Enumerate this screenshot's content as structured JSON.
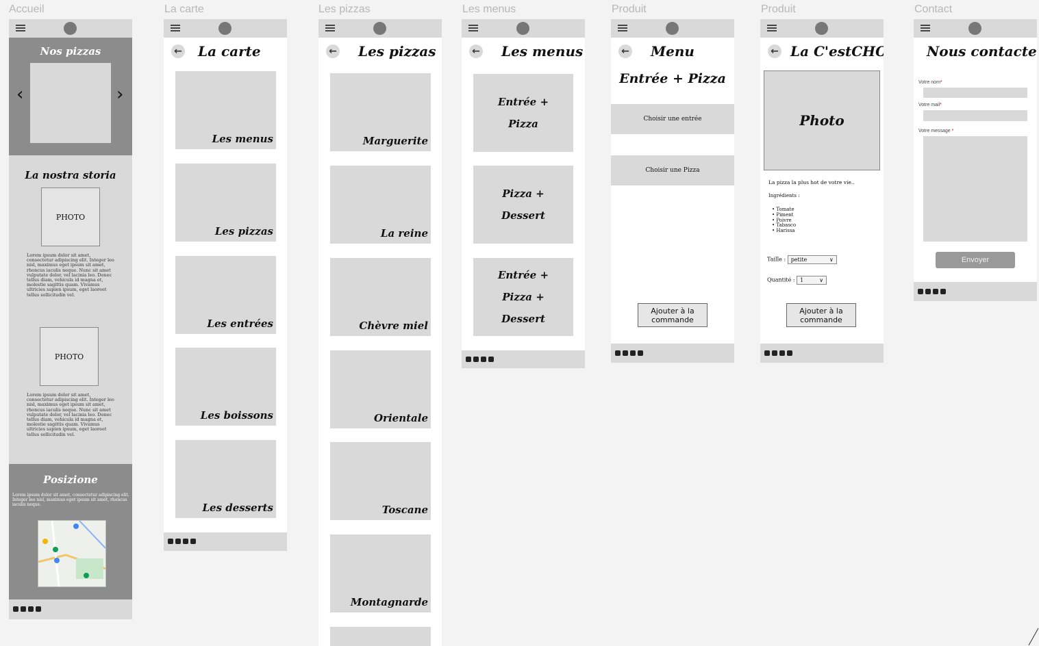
{
  "labels": [
    "Accueil",
    "La carte",
    "Les pizzas",
    "Les menus",
    "Produit",
    "Produit",
    "Contact"
  ],
  "accueil": {
    "hero_title": "Nos pizzas",
    "prev_arrow": "‹",
    "next_arrow": "›",
    "story_title": "La nostra storia",
    "photo1": "PHOTO",
    "lorem1": "Lorem ipsum dolor sit amet, consectetur adipiscing elit. Integer leo nisl, maximus eget ipsum sit amet, rhoncus iaculis neque. Nunc sit amet vulputate dolor, vel lacinia leo. Donec tellus diam, vehicula id magna et, molestie sagittis quam. Vivamus ultricies sapien ipsum, eget laoreet tellus sollicitudin vel.",
    "photo2": "PHOTO",
    "lorem2": "Lorem ipsum dolor sit amet, consectetur adipiscing elit. Integer leo nisl, maximus eget ipsum sit amet, rhoncus iaculis neque. Nunc sit amet vulputate dolor, vel lacinia leo. Donec tellus diam, vehicula id magna et, molestie sagittis quam. Vivamus ultricies sapien ipsum, eget laoreet tellus sollicitudin vel.",
    "pos_title": "Posizione",
    "pos_text": "Lorem ipsum dolor sit amet, consectetur adipiscing elit. Integer leo nisl, maximus eget ipsum sit amet, rhoncus iaculis neque."
  },
  "carte": {
    "title": "La carte",
    "items": [
      "Les menus",
      "Les pizzas",
      "Les entrées",
      "Les boissons",
      "Les desserts"
    ]
  },
  "pizzas": {
    "title": "Les pizzas",
    "items": [
      "Marguerite",
      "La reine",
      "Chèvre miel",
      "Orientale",
      "Toscane",
      "Montagnarde"
    ]
  },
  "menus": {
    "title": "Les menus",
    "items": [
      [
        "Entrée +",
        "Pizza"
      ],
      [
        "Pizza +",
        "Dessert"
      ],
      [
        "Entrée +",
        "Pizza +",
        "Dessert"
      ]
    ]
  },
  "produit_menu": {
    "title": "Menu",
    "subtitle": "Entrée + Pizza",
    "choose_starter": "Choisir une entrée",
    "choose_pizza": "Choisir une Pizza",
    "add_button": [
      "Ajouter à la",
      "commande"
    ]
  },
  "produit_pizza": {
    "title": "La C'estCHO",
    "photo": "Photo",
    "tagline": "La pizza la plus hot de votre vie..",
    "ingredients_label": "Ingrédients :",
    "ingredients": [
      "Tomate",
      "Piment",
      "Poivre",
      "Tabasco",
      "Harissa"
    ],
    "size_label": "Taille :",
    "size_value": "petite",
    "qty_label": "Quantité :",
    "qty_value": "1",
    "add_button": [
      "Ajouter à la",
      "commande"
    ]
  },
  "contact": {
    "title": "Nous contacter",
    "name_label": "Votre nom",
    "mail_label": "Votre mail",
    "message_label": "Votre message ",
    "required_mark": "*",
    "send_button": "Envoyer"
  },
  "icons": {
    "burger": "menu-icon",
    "back": "←",
    "social": [
      "facebook-icon",
      "instagram-icon",
      "x-icon",
      "tiktok-icon"
    ]
  }
}
